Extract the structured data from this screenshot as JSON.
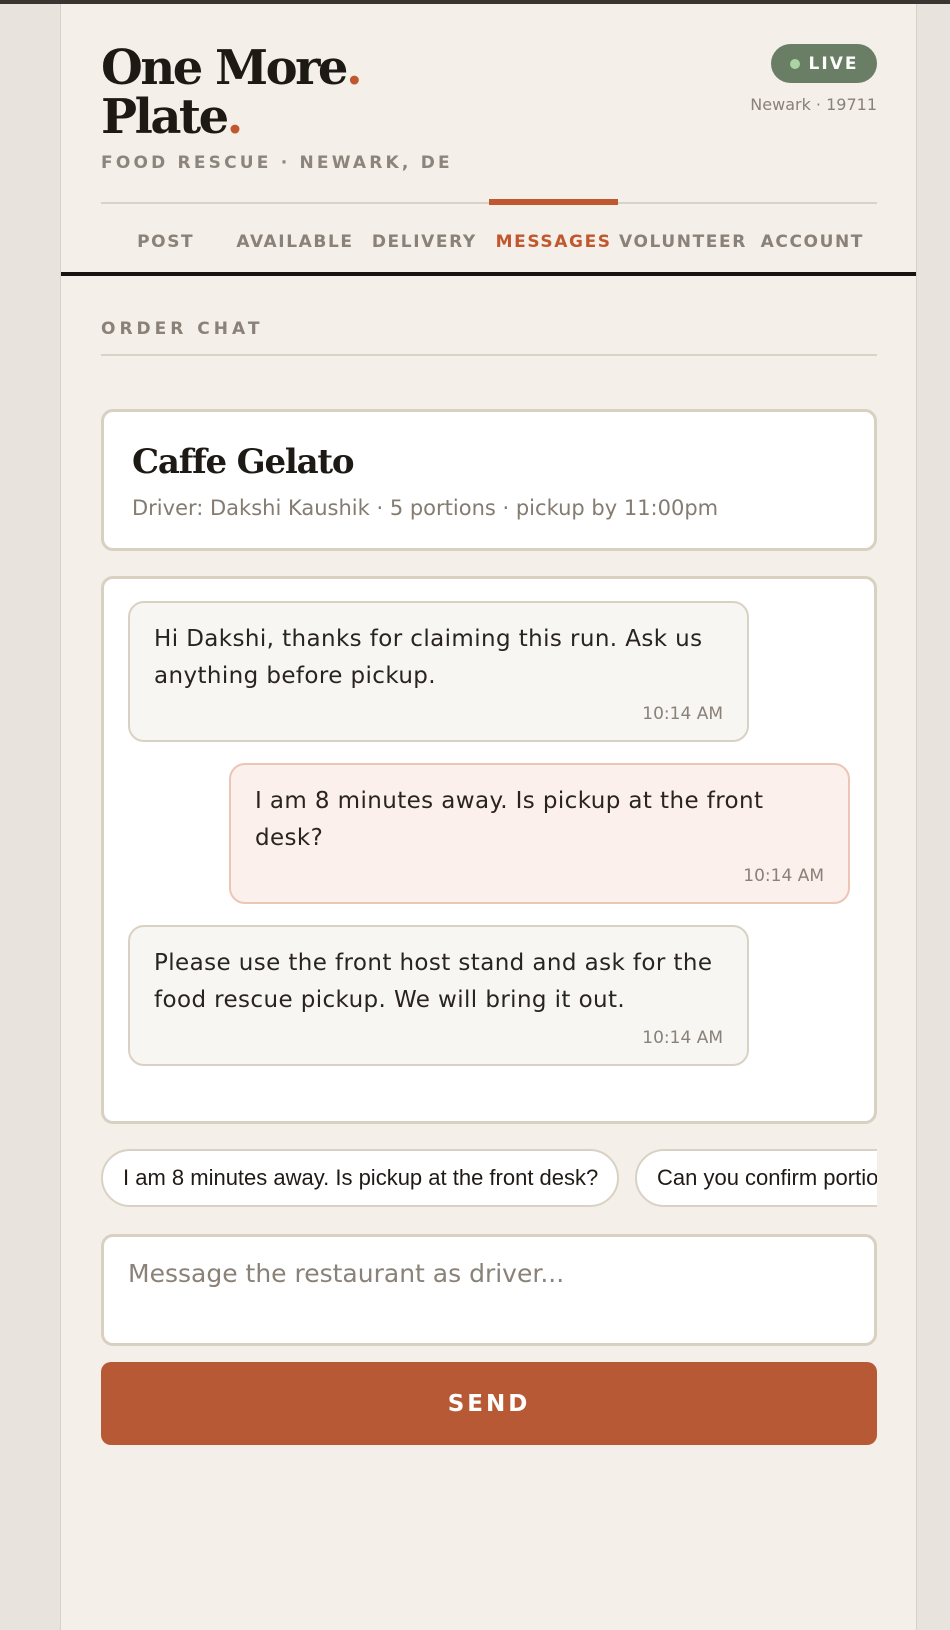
{
  "brand": {
    "line1": "One More",
    "line2": "Plate",
    "dot": ".",
    "tagline": "FOOD RESCUE · NEWARK, DE"
  },
  "status": {
    "live_label": "LIVE",
    "location": "Newark · 19711"
  },
  "nav": {
    "tabs": [
      {
        "label": "POST",
        "active": false
      },
      {
        "label": "AVAILABLE",
        "active": false
      },
      {
        "label": "DELIVERY",
        "active": false
      },
      {
        "label": "MESSAGES",
        "active": true
      },
      {
        "label": "VOLUNTEER",
        "active": false
      },
      {
        "label": "ACCOUNT",
        "active": false
      }
    ]
  },
  "section": {
    "title": "ORDER CHAT"
  },
  "order": {
    "name": "Caffe Gelato",
    "meta": "Driver: Dakshi Kaushik · 5 portions · pickup by 11:00pm"
  },
  "messages": [
    {
      "text": "Hi Dakshi, thanks for claiming this run. Ask us anything before pickup.",
      "time": "10:14 AM",
      "from": "restaurant"
    },
    {
      "text": "I am 8 minutes away. Is pickup at the front desk?",
      "time": "10:14 AM",
      "from": "driver"
    },
    {
      "text": "Please use the front host stand and ask for the food rescue pickup. We will bring it out.",
      "time": "10:14 AM",
      "from": "restaurant"
    }
  ],
  "quick_replies": [
    "I am 8 minutes away. Is pickup at the front desk?",
    "Can you confirm portions are ready?"
  ],
  "composer": {
    "placeholder": "Message the restaurant as driver...",
    "value": "",
    "send_label": "SEND"
  },
  "colors": {
    "accent": "#c0582f",
    "send_button": "#b85935",
    "live_badge": "#6a7d65",
    "background": "#f4efe8"
  }
}
